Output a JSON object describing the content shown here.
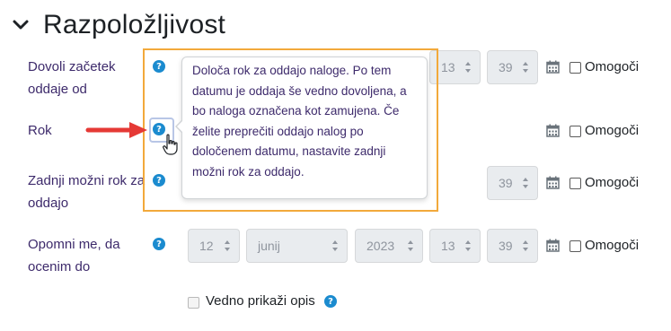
{
  "section": {
    "title": "Razpoložljivost"
  },
  "rows": [
    {
      "label": "Dovoli začetek oddaje od",
      "hour": "13",
      "minute": "39",
      "enable_label": "Omogoči"
    },
    {
      "label": "Rok",
      "enable_label": "Omogoči"
    },
    {
      "label": "Zadnji možni rok za oddajo",
      "minute": "39",
      "enable_label": "Omogoči"
    },
    {
      "label": "Opomni me, da ocenim do",
      "day": "12",
      "month": "junij",
      "year": "2023",
      "hour": "13",
      "minute": "39",
      "enable_label": "Omogoči"
    }
  ],
  "always_show_description": {
    "label": "Vedno prikaži opis"
  },
  "tooltip": {
    "text": "Določa rok za oddajo naloge. Po tem datumu je oddaja še vedno dovoljena, a bo naloga označena kot zamujena. Če želite preprečiti oddajo nalog po določenem datumu, nastavite zadnji možni rok za oddajo."
  },
  "icons": {
    "section": "chevron-down-icon",
    "help": "question-circle-icon",
    "calendar": "calendar-icon",
    "pointer": "hand-pointer-icon",
    "annotation": "red-arrow-icon"
  },
  "colors": {
    "help_icon": "#1b8bcf",
    "label_text": "#3d2a6b",
    "highlight_border": "#f2a93b",
    "arrow": "#e53935"
  }
}
